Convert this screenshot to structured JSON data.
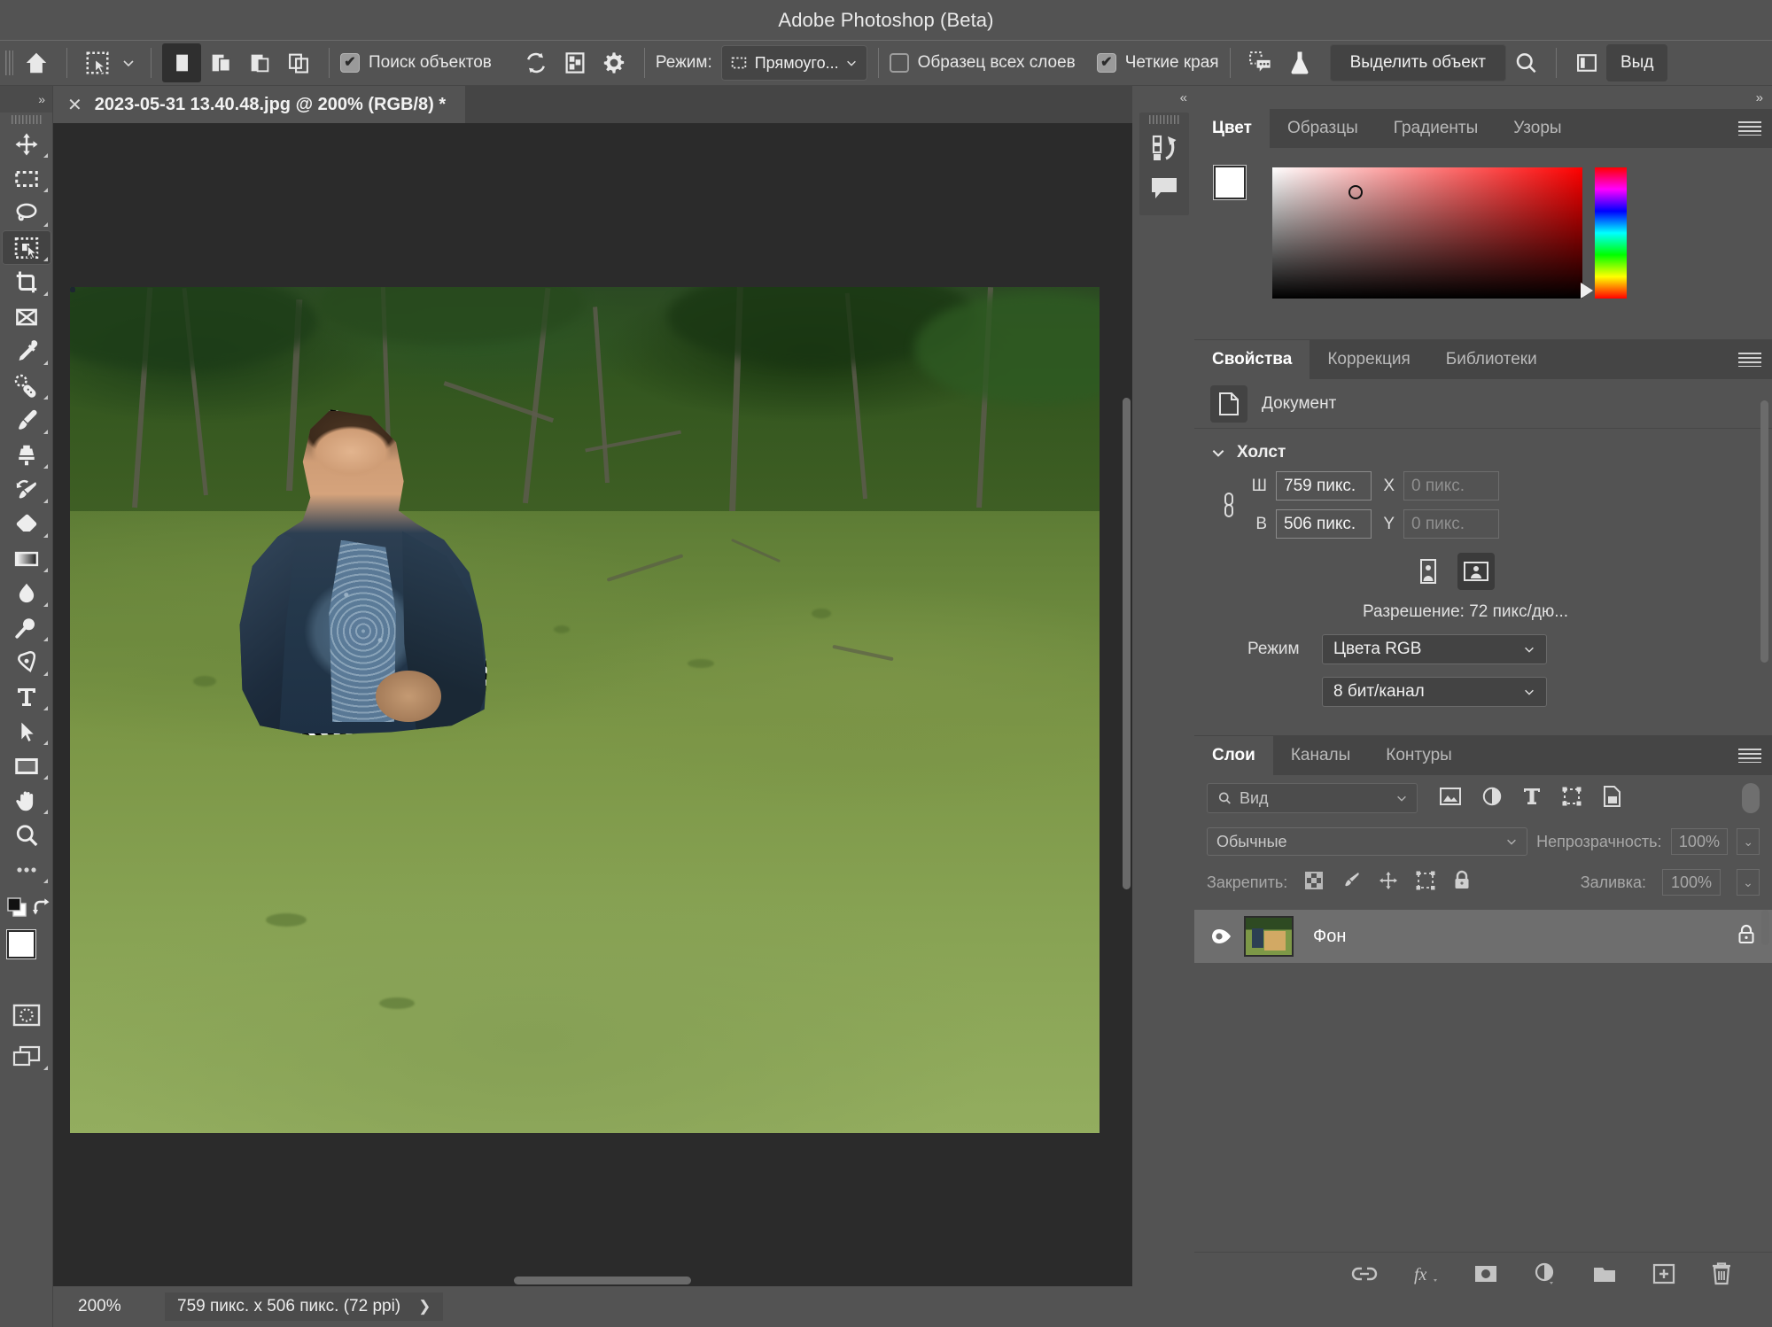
{
  "app": {
    "title": "Adobe Photoshop (Beta)"
  },
  "options_bar": {
    "home_icon": "home-icon",
    "tool_preset_icon": "object-selection-tool-icon",
    "tool_preset_caret": "chevron-down-icon",
    "selection_modes": [
      {
        "name": "new-selection",
        "icon": "new-selection-icon",
        "selected": true
      },
      {
        "name": "add-to-selection",
        "icon": "add-to-selection-icon",
        "selected": false
      },
      {
        "name": "subtract-from-selection",
        "icon": "subtract-from-selection-icon",
        "selected": false
      },
      {
        "name": "intersect-selection",
        "icon": "intersect-selection-icon",
        "selected": false
      }
    ],
    "object_finder": {
      "label": "Поиск объектов",
      "checked": true
    },
    "refresh_icon": "refresh-icon",
    "overlay_icon": "show-overlay-icon",
    "settings_icon": "gear-icon",
    "mode_label": "Режим:",
    "mode_value": "Прямоуго...",
    "sample_all_layers": {
      "label": "Образец всех слоев",
      "checked": false
    },
    "hard_edges": {
      "label": "Четкие края",
      "checked": true
    },
    "feedback_icon": "selection-feedback-icon",
    "flask_icon": "beta-flask-icon",
    "select_subject_label": "Выделить объект",
    "search_icon": "search-icon",
    "workspace_icon": "select-and-mask-panel-icon",
    "select_mask_label": "Выд"
  },
  "toolbar": {
    "expand_label": "»",
    "tools": [
      {
        "name": "move-tool",
        "icon": "move-icon",
        "active": false
      },
      {
        "name": "rectangular-marquee-tool",
        "icon": "marquee-icon",
        "active": false
      },
      {
        "name": "lasso-tool",
        "icon": "lasso-icon",
        "active": false
      },
      {
        "name": "object-selection-tool",
        "icon": "object-selection-icon",
        "active": true
      },
      {
        "name": "crop-tool",
        "icon": "crop-icon",
        "active": false
      },
      {
        "name": "frame-tool",
        "icon": "frame-icon",
        "active": false
      },
      {
        "name": "eyedropper-tool",
        "icon": "eyedropper-icon",
        "active": false
      },
      {
        "name": "spot-healing-brush-tool",
        "icon": "healing-brush-icon",
        "active": false
      },
      {
        "name": "brush-tool",
        "icon": "brush-icon",
        "active": false
      },
      {
        "name": "clone-stamp-tool",
        "icon": "clone-stamp-icon",
        "active": false
      },
      {
        "name": "history-brush-tool",
        "icon": "history-brush-icon",
        "active": false
      },
      {
        "name": "eraser-tool",
        "icon": "eraser-icon",
        "active": false
      },
      {
        "name": "gradient-tool",
        "icon": "gradient-icon",
        "active": false
      },
      {
        "name": "blur-tool",
        "icon": "blur-drop-icon",
        "active": false
      },
      {
        "name": "dodge-tool",
        "icon": "dodge-icon",
        "active": false
      },
      {
        "name": "pen-tool",
        "icon": "pen-icon",
        "active": false
      },
      {
        "name": "type-tool",
        "icon": "type-t-icon",
        "active": false
      },
      {
        "name": "path-selection-tool",
        "icon": "path-arrow-icon",
        "active": false
      },
      {
        "name": "rectangle-tool",
        "icon": "rectangle-icon",
        "active": false
      },
      {
        "name": "hand-tool",
        "icon": "hand-icon",
        "active": false
      },
      {
        "name": "zoom-tool",
        "icon": "zoom-magnifier-icon",
        "active": false
      },
      {
        "name": "edit-toolbar",
        "icon": "more-dots-icon",
        "active": false
      }
    ],
    "default_colors_icon": "default-foreground-background-icon",
    "swap_colors_icon": "swap-colors-icon",
    "foreground_color": "#ffffff",
    "background_color": "#ffffff",
    "quick_mask_icon": "quick-mask-icon",
    "screen_mode_icon": "screen-mode-icon"
  },
  "document": {
    "tab_close_icon": "close-icon",
    "tab_title": "2023-05-31 13.40.48.jpg @ 200% (RGB/8) *"
  },
  "status_bar": {
    "zoom": "200%",
    "dimensions": "759 пикс. x 506 пикс. (72 ppi)",
    "expand_icon": "chevron-right-icon"
  },
  "mini_column": {
    "collapse_label": "«",
    "buttons": [
      {
        "name": "history-panel-icon",
        "icon": "history-icon"
      },
      {
        "name": "comments-panel-icon",
        "icon": "comment-bubble-icon"
      }
    ]
  },
  "right_dock": {
    "expand_label": "»",
    "color_panel": {
      "tabs": [
        {
          "label": "Цвет",
          "active": true
        },
        {
          "label": "Образцы",
          "active": false
        },
        {
          "label": "Градиенты",
          "active": false
        },
        {
          "label": "Узоры",
          "active": false
        }
      ],
      "menu_icon": "panel-menu-icon",
      "foreground_color": "#ffffff",
      "background_color": "#ffffff"
    },
    "properties_panel": {
      "tabs": [
        {
          "label": "Свойства",
          "active": true
        },
        {
          "label": "Коррекция",
          "active": false
        },
        {
          "label": "Библиотеки",
          "active": false
        }
      ],
      "menu_icon": "panel-menu-icon",
      "doc_icon": "document-icon",
      "doc_label": "Документ",
      "section_title": "Холст",
      "section_caret": "chevron-down-icon",
      "link_icon": "link-dimensions-icon",
      "width_label": "Ш",
      "width_value": "759 пикс.",
      "height_label": "В",
      "height_value": "506 пикс.",
      "x_label": "X",
      "x_value": "0 пикс.",
      "y_label": "Y",
      "y_value": "0 пикс.",
      "orientation_portrait_icon": "portrait-orientation-icon",
      "orientation_landscape_icon": "landscape-orientation-icon",
      "resolution": "Разрешение: 72 пикс/дю...",
      "mode_label": "Режим",
      "mode_value": "Цвета RGB",
      "depth_value": "8 бит/канал",
      "mode_caret": "chevron-down-icon"
    },
    "layers_panel": {
      "tabs": [
        {
          "label": "Слои",
          "active": true
        },
        {
          "label": "Каналы",
          "active": false
        },
        {
          "label": "Контуры",
          "active": false
        }
      ],
      "menu_icon": "panel-menu-icon",
      "filter_placeholder": "Вид",
      "filter_search_icon": "search-icon",
      "filter_caret": "chevron-down-icon",
      "filter_icons": [
        "pixel-layer-filter-icon",
        "adjustment-layer-filter-icon",
        "type-layer-filter-icon",
        "shape-layer-filter-icon",
        "smart-object-filter-icon"
      ],
      "filter_toggle": "filter-toggle",
      "blend_mode": "Обычные",
      "opacity_label": "Непрозрачность:",
      "opacity_value": "100%",
      "lock_label": "Закрепить:",
      "lock_icons": [
        "lock-transparent-pixels-icon",
        "lock-image-pixels-icon",
        "lock-position-icon",
        "lock-artboard-nesting-icon",
        "lock-all-icon"
      ],
      "fill_label": "Заливка:",
      "fill_value": "100%",
      "layers": [
        {
          "name": "Фон",
          "visible": true,
          "visibility_icon": "eye-icon",
          "lock_icon": "lock-icon",
          "selected": true
        }
      ],
      "footer_icons": [
        "link-layers-icon",
        "layer-style-fx-icon",
        "add-layer-mask-icon",
        "new-adjustment-layer-icon",
        "new-group-icon",
        "new-layer-icon",
        "delete-layer-icon"
      ]
    }
  },
  "canvas": {
    "selection": "marching-ants-selection-around-person",
    "scene_description": "photo of a man in a dark blue suit sitting at a wooden desk in green duckweed swamp water"
  },
  "colors": {
    "app_bg": "#535353",
    "panel_tab_bg": "#454545",
    "canvas_bg": "#2b2b2b",
    "active_tool_bg": "#434343",
    "text": "#eaeaea",
    "dim_text": "#a8a8a8",
    "selected_layer_bg": "#6e6e6e"
  }
}
